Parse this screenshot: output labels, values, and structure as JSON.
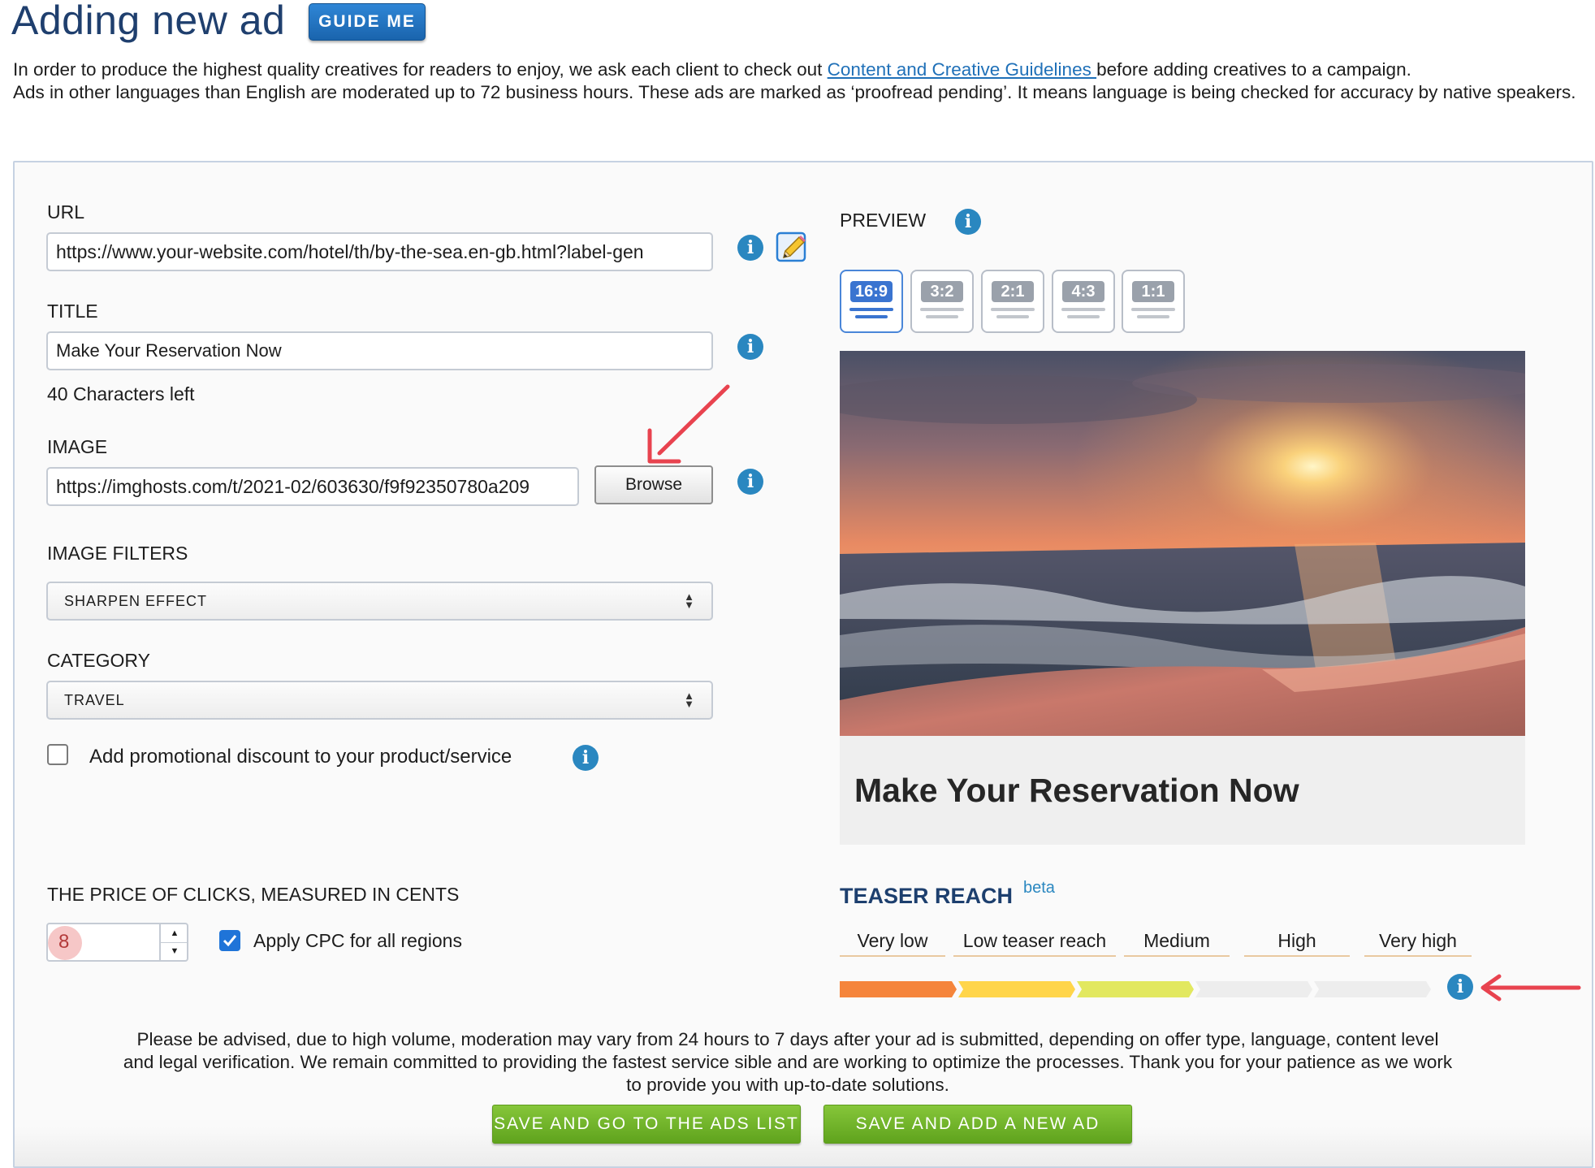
{
  "header": {
    "title": "Adding new ad",
    "guide_label": "GUIDE ME"
  },
  "intro": {
    "before_link": "In order to produce the highest quality creatives for readers to enjoy, we ask each client to check out ",
    "link": "Content and Creative Guidelines ",
    "after_link": "before adding creatives to a campaign.",
    "line2": "Ads in other languages than English are moderated up to 72 business hours. These ads are marked as ‘proofread pending’. It means language is being checked for accuracy by native speakers."
  },
  "form": {
    "url_label": "URL",
    "url_value": "https://www.your-website.com/hotel/th/by-the-sea.en-gb.html?label-gen",
    "title_label": "TITLE",
    "title_value": "Make Your Reservation Now",
    "chars_left": "40 Characters left",
    "image_label": "IMAGE",
    "image_value": "https://imghosts.com/t/2021-02/603630/f9f92350780a209",
    "browse_label": "Browse",
    "filters_label": "IMAGE FILTERS",
    "filters_value": "SHARPEN EFFECT",
    "category_label": "CATEGORY",
    "category_value": "TRAVEL",
    "promo_label": "Add promotional discount to your product/service",
    "promo_checked": false,
    "price_label": "THE PRICE OF CLICKS, MEASURED IN CENTS",
    "price_value": "8",
    "cpc_label": "Apply CPC for all regions",
    "cpc_checked": true
  },
  "preview": {
    "label": "PREVIEW",
    "ratios": [
      "16:9",
      "3:2",
      "2:1",
      "4:3",
      "1:1"
    ],
    "active_ratio": "16:9",
    "ad_title": "Make Your Reservation Now"
  },
  "reach": {
    "title": "TEASER REACH",
    "beta": "beta",
    "levels": [
      "Very low",
      "Low teaser reach",
      "Medium",
      "High",
      "Very high"
    ],
    "filled_segments": 3,
    "colors": [
      "#f5853b",
      "#ffd54a",
      "#e2e860",
      "#ededed",
      "#ededed"
    ]
  },
  "footer": {
    "notice": "Please be advised, due to high volume, moderation may vary from 24 hours to 7 days after your ad is submitted, depending on offer type, language, content level and legal verification. We remain committed to providing the fastest service sible and are working to optimize the processes. Thank you for your patience as we work to provide you with up-to-date solutions.",
    "save_list_label": "SAVE AND GO TO THE ADS LIST",
    "save_new_label": "SAVE AND ADD A NEW AD"
  },
  "colors": {
    "title": "#1f3f6e",
    "link": "#1f70b8",
    "info": "#2a87c0",
    "annotation_arrow": "#e8434f",
    "green_button": "#6bb02a"
  },
  "icons": [
    "info-icon",
    "pencil-icon",
    "arrow-annotation",
    "checkmark-icon"
  ]
}
